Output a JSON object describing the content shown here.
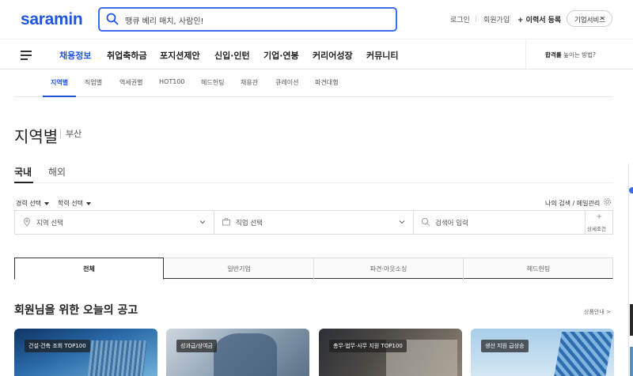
{
  "header": {
    "logo": "saramin",
    "search_placeholder": "땡큐 베리 매치, 사람인!",
    "login": "로그인",
    "signup": "회원가입",
    "resume_register": "+ 이력서 등록",
    "corp_service": "기업서비스"
  },
  "gnb": {
    "items": [
      "채용정보",
      "취업축하금",
      "포지션제안",
      "신입·인턴",
      "기업·연봉",
      "커리어성장",
      "커뮤니티"
    ],
    "tip_strong": "합격률",
    "tip_rest": "높이는 방법?"
  },
  "subnav": {
    "items": [
      "지역별",
      "직업별",
      "역세권별",
      "HOT100",
      "헤드헌팅",
      "채용관",
      "큐레이션",
      "파견대행"
    ]
  },
  "page": {
    "title": "지역별",
    "subtitle": "부산"
  },
  "tabs": [
    "국내",
    "해외"
  ],
  "filters": {
    "career": "경력 선택",
    "education": "학력 선택",
    "my_search": "나의 검색 / 메일관리",
    "region": "지역 선택",
    "job": "직업 선택",
    "keyword_placeholder": "검색어 입력",
    "detail_plus": "+",
    "detail": "상세조건"
  },
  "segments": [
    "전체",
    "일반기업",
    "파견·아웃소싱",
    "헤드헌팅"
  ],
  "section": {
    "title": "회원님을 위한 오늘의 공고",
    "more": "상품안내 >"
  },
  "cards": [
    {
      "badge": "건설·건축 조회 TOP100"
    },
    {
      "badge": "성과급/상여금"
    },
    {
      "badge": "총무·법무·사무 지원 TOP100"
    },
    {
      "badge": "생산 지원 급상승"
    }
  ],
  "colors": {
    "brand": "#1f55e0",
    "search_border": "#3c6df0"
  }
}
